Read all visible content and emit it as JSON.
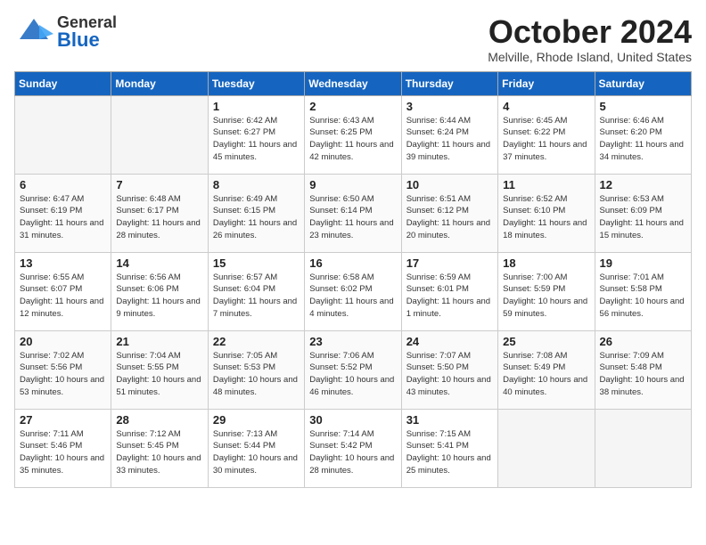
{
  "header": {
    "logo_general": "General",
    "logo_blue": "Blue",
    "month": "October 2024",
    "location": "Melville, Rhode Island, United States"
  },
  "weekdays": [
    "Sunday",
    "Monday",
    "Tuesday",
    "Wednesday",
    "Thursday",
    "Friday",
    "Saturday"
  ],
  "weeks": [
    [
      {
        "day": "",
        "empty": true
      },
      {
        "day": "",
        "empty": true
      },
      {
        "day": "1",
        "sunrise": "Sunrise: 6:42 AM",
        "sunset": "Sunset: 6:27 PM",
        "daylight": "Daylight: 11 hours and 45 minutes."
      },
      {
        "day": "2",
        "sunrise": "Sunrise: 6:43 AM",
        "sunset": "Sunset: 6:25 PM",
        "daylight": "Daylight: 11 hours and 42 minutes."
      },
      {
        "day": "3",
        "sunrise": "Sunrise: 6:44 AM",
        "sunset": "Sunset: 6:24 PM",
        "daylight": "Daylight: 11 hours and 39 minutes."
      },
      {
        "day": "4",
        "sunrise": "Sunrise: 6:45 AM",
        "sunset": "Sunset: 6:22 PM",
        "daylight": "Daylight: 11 hours and 37 minutes."
      },
      {
        "day": "5",
        "sunrise": "Sunrise: 6:46 AM",
        "sunset": "Sunset: 6:20 PM",
        "daylight": "Daylight: 11 hours and 34 minutes."
      }
    ],
    [
      {
        "day": "6",
        "sunrise": "Sunrise: 6:47 AM",
        "sunset": "Sunset: 6:19 PM",
        "daylight": "Daylight: 11 hours and 31 minutes."
      },
      {
        "day": "7",
        "sunrise": "Sunrise: 6:48 AM",
        "sunset": "Sunset: 6:17 PM",
        "daylight": "Daylight: 11 hours and 28 minutes."
      },
      {
        "day": "8",
        "sunrise": "Sunrise: 6:49 AM",
        "sunset": "Sunset: 6:15 PM",
        "daylight": "Daylight: 11 hours and 26 minutes."
      },
      {
        "day": "9",
        "sunrise": "Sunrise: 6:50 AM",
        "sunset": "Sunset: 6:14 PM",
        "daylight": "Daylight: 11 hours and 23 minutes."
      },
      {
        "day": "10",
        "sunrise": "Sunrise: 6:51 AM",
        "sunset": "Sunset: 6:12 PM",
        "daylight": "Daylight: 11 hours and 20 minutes."
      },
      {
        "day": "11",
        "sunrise": "Sunrise: 6:52 AM",
        "sunset": "Sunset: 6:10 PM",
        "daylight": "Daylight: 11 hours and 18 minutes."
      },
      {
        "day": "12",
        "sunrise": "Sunrise: 6:53 AM",
        "sunset": "Sunset: 6:09 PM",
        "daylight": "Daylight: 11 hours and 15 minutes."
      }
    ],
    [
      {
        "day": "13",
        "sunrise": "Sunrise: 6:55 AM",
        "sunset": "Sunset: 6:07 PM",
        "daylight": "Daylight: 11 hours and 12 minutes."
      },
      {
        "day": "14",
        "sunrise": "Sunrise: 6:56 AM",
        "sunset": "Sunset: 6:06 PM",
        "daylight": "Daylight: 11 hours and 9 minutes."
      },
      {
        "day": "15",
        "sunrise": "Sunrise: 6:57 AM",
        "sunset": "Sunset: 6:04 PM",
        "daylight": "Daylight: 11 hours and 7 minutes."
      },
      {
        "day": "16",
        "sunrise": "Sunrise: 6:58 AM",
        "sunset": "Sunset: 6:02 PM",
        "daylight": "Daylight: 11 hours and 4 minutes."
      },
      {
        "day": "17",
        "sunrise": "Sunrise: 6:59 AM",
        "sunset": "Sunset: 6:01 PM",
        "daylight": "Daylight: 11 hours and 1 minute."
      },
      {
        "day": "18",
        "sunrise": "Sunrise: 7:00 AM",
        "sunset": "Sunset: 5:59 PM",
        "daylight": "Daylight: 10 hours and 59 minutes."
      },
      {
        "day": "19",
        "sunrise": "Sunrise: 7:01 AM",
        "sunset": "Sunset: 5:58 PM",
        "daylight": "Daylight: 10 hours and 56 minutes."
      }
    ],
    [
      {
        "day": "20",
        "sunrise": "Sunrise: 7:02 AM",
        "sunset": "Sunset: 5:56 PM",
        "daylight": "Daylight: 10 hours and 53 minutes."
      },
      {
        "day": "21",
        "sunrise": "Sunrise: 7:04 AM",
        "sunset": "Sunset: 5:55 PM",
        "daylight": "Daylight: 10 hours and 51 minutes."
      },
      {
        "day": "22",
        "sunrise": "Sunrise: 7:05 AM",
        "sunset": "Sunset: 5:53 PM",
        "daylight": "Daylight: 10 hours and 48 minutes."
      },
      {
        "day": "23",
        "sunrise": "Sunrise: 7:06 AM",
        "sunset": "Sunset: 5:52 PM",
        "daylight": "Daylight: 10 hours and 46 minutes."
      },
      {
        "day": "24",
        "sunrise": "Sunrise: 7:07 AM",
        "sunset": "Sunset: 5:50 PM",
        "daylight": "Daylight: 10 hours and 43 minutes."
      },
      {
        "day": "25",
        "sunrise": "Sunrise: 7:08 AM",
        "sunset": "Sunset: 5:49 PM",
        "daylight": "Daylight: 10 hours and 40 minutes."
      },
      {
        "day": "26",
        "sunrise": "Sunrise: 7:09 AM",
        "sunset": "Sunset: 5:48 PM",
        "daylight": "Daylight: 10 hours and 38 minutes."
      }
    ],
    [
      {
        "day": "27",
        "sunrise": "Sunrise: 7:11 AM",
        "sunset": "Sunset: 5:46 PM",
        "daylight": "Daylight: 10 hours and 35 minutes."
      },
      {
        "day": "28",
        "sunrise": "Sunrise: 7:12 AM",
        "sunset": "Sunset: 5:45 PM",
        "daylight": "Daylight: 10 hours and 33 minutes."
      },
      {
        "day": "29",
        "sunrise": "Sunrise: 7:13 AM",
        "sunset": "Sunset: 5:44 PM",
        "daylight": "Daylight: 10 hours and 30 minutes."
      },
      {
        "day": "30",
        "sunrise": "Sunrise: 7:14 AM",
        "sunset": "Sunset: 5:42 PM",
        "daylight": "Daylight: 10 hours and 28 minutes."
      },
      {
        "day": "31",
        "sunrise": "Sunrise: 7:15 AM",
        "sunset": "Sunset: 5:41 PM",
        "daylight": "Daylight: 10 hours and 25 minutes."
      },
      {
        "day": "",
        "empty": true
      },
      {
        "day": "",
        "empty": true
      }
    ]
  ]
}
